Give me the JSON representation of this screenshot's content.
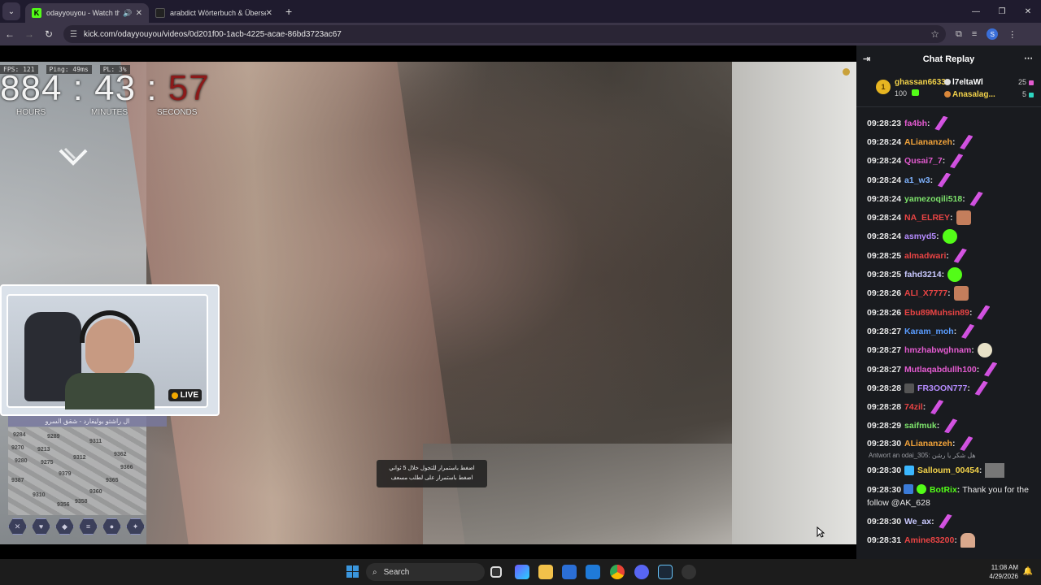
{
  "browser": {
    "tabs": [
      {
        "title": "odayyouyou - Watch the Vi",
        "active": true
      },
      {
        "title": "arabdict Wörterbuch & Überse",
        "active": false
      }
    ],
    "url": "kick.com/odayyouyou/videos/0d201f00-1acb-4225-acae-86bd3723ac67",
    "profile_letter": "S"
  },
  "video": {
    "hud": {
      "fps": "FPS: 121",
      "ping": "Ping: 49ms",
      "pl": "PL: 3%"
    },
    "timer": {
      "hours": "884",
      "minutes": "43",
      "seconds": "57",
      "sep": ":",
      "hours_label": "HOURS",
      "minutes_label": "MINUTES",
      "seconds_label": "SECONDS"
    },
    "live_label": "LIVE",
    "map_label": "ال راشتو بوليفارد - شقق السرو",
    "map_numbers": [
      "9284",
      "9289",
      "9270",
      "9213",
      "9280",
      "9275",
      "9379",
      "9387",
      "9362",
      "9366",
      "9365",
      "9360",
      "9358",
      "9356",
      "9310",
      "9311",
      "9312"
    ],
    "prompt_line1": "اضغط باستمرار للتجول خلال 5 ثواني",
    "prompt_line2": "اضغط باستمرار على لطلب مسعف"
  },
  "chat": {
    "title": "Chat Replay",
    "pinned": {
      "top_rank": "1",
      "top_user": "ghassan6633",
      "top_count": "100",
      "user2": "l7eltaWl",
      "count2": "25",
      "user3": "Anasalag...",
      "count3": "5"
    },
    "colors": {
      "green": "#53fc18",
      "pink": "#e35bd0",
      "yellow": "#f2d24a"
    },
    "messages": [
      {
        "time": "09:28:23",
        "user": "fa4bh",
        "color": "#e35bd0",
        "emote": "feather"
      },
      {
        "time": "09:28:24",
        "user": "ALiananzeh",
        "color": "#f2a33a",
        "emote": "feather"
      },
      {
        "time": "09:28:24",
        "user": "Qusai7_7",
        "color": "#e35bd0",
        "emote": "feather"
      },
      {
        "time": "09:28:24",
        "user": "a1_w3",
        "color": "#7fb3ff",
        "emote": "feather"
      },
      {
        "time": "09:28:24",
        "user": "yamezoqili518",
        "color": "#7de36b",
        "emote": "feather"
      },
      {
        "time": "09:28:24",
        "user": "NA_ELREY",
        "color": "#e94444",
        "emote": "face"
      },
      {
        "time": "09:28:24",
        "user": "asmyd5",
        "color": "#b58cff",
        "emote": "green"
      },
      {
        "time": "09:28:25",
        "user": "almadwari",
        "color": "#e94444",
        "emote": "feather"
      },
      {
        "time": "09:28:25",
        "user": "fahd3214",
        "color": "#c9c9ff",
        "emote": "green"
      },
      {
        "time": "09:28:26",
        "user": "ALI_X7777",
        "color": "#e94444",
        "emote": "face"
      },
      {
        "time": "09:28:26",
        "user": "Ebu89Muhsin89",
        "color": "#e94444",
        "emote": "feather"
      },
      {
        "time": "09:28:27",
        "user": "Karam_moh",
        "color": "#5a9cff",
        "emote": "feather"
      },
      {
        "time": "09:28:27",
        "user": "hmzhabwghnam",
        "color": "#e35bd0",
        "emote": "duck"
      },
      {
        "time": "09:28:27",
        "user": "Mutlaqabdullh100",
        "color": "#e35bd0",
        "emote": "feather"
      },
      {
        "time": "09:28:28",
        "user": "FR3OON777",
        "color": "#b58cff",
        "emote": "feather"
      },
      {
        "time": "09:28:28",
        "user": "74zil",
        "color": "#e94444",
        "emote": "feather"
      },
      {
        "time": "09:28:29",
        "user": "saifmuk",
        "color": "#7de36b",
        "emote": "feather"
      },
      {
        "time": "09:28:30",
        "user": "ALiananzeh",
        "color": "#f2a33a",
        "emote": "feather"
      }
    ],
    "reply_note": "Antwort an odai_305: هل شكر يا رشن",
    "reply_msg": {
      "time": "09:28:30",
      "user": "Salloum_00454",
      "color": "#f2d24a"
    },
    "long_msg": {
      "time": "09:28:30",
      "user": "BotRix",
      "color": "#53fc18",
      "text": "Thank you for the follow @AK_628"
    },
    "tail_msgs": [
      {
        "time": "09:28:30",
        "user": "We_ax",
        "color": "#c9c9ff",
        "emote": "feather"
      },
      {
        "time": "09:28:31",
        "user": "Amine83200",
        "color": "#e94444",
        "emote": "hand"
      }
    ]
  },
  "taskbar": {
    "search_placeholder": "Search",
    "time": "11:08 AM",
    "date": "4/29/2026"
  }
}
